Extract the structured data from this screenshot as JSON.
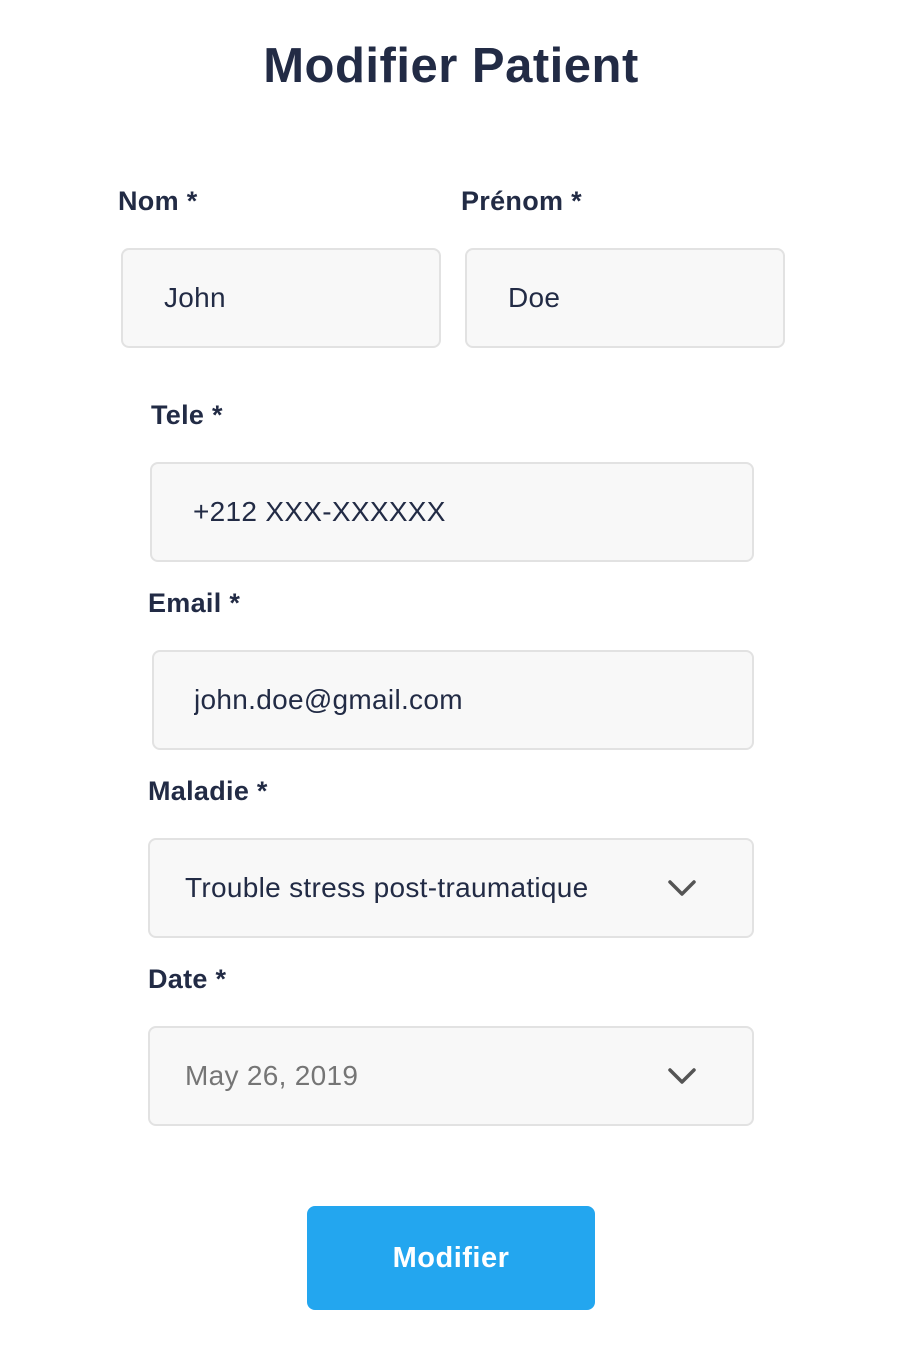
{
  "page": {
    "title": "Modifier Patient"
  },
  "form": {
    "nom": {
      "label": "Nom *",
      "value": "John"
    },
    "prenom": {
      "label": "Prénom *",
      "value": "Doe"
    },
    "tele": {
      "label": "Tele *",
      "value": "+212 XXX-XXXXXX"
    },
    "email": {
      "label": "Email *",
      "value": "john.doe@gmail.com"
    },
    "maladie": {
      "label": "Maladie *",
      "value": "Trouble stress post-traumatique",
      "icon": "chevron-down-icon"
    },
    "date": {
      "label": "Date *",
      "value": "May 26, 2019",
      "icon": "chevron-down-icon"
    },
    "submit_label": "Modifier"
  },
  "colors": {
    "text": "#222b45",
    "field_bg": "#f8f8f8",
    "field_border": "#e2e2e2",
    "button": "#23a6ef",
    "muted_text": "#757575"
  }
}
